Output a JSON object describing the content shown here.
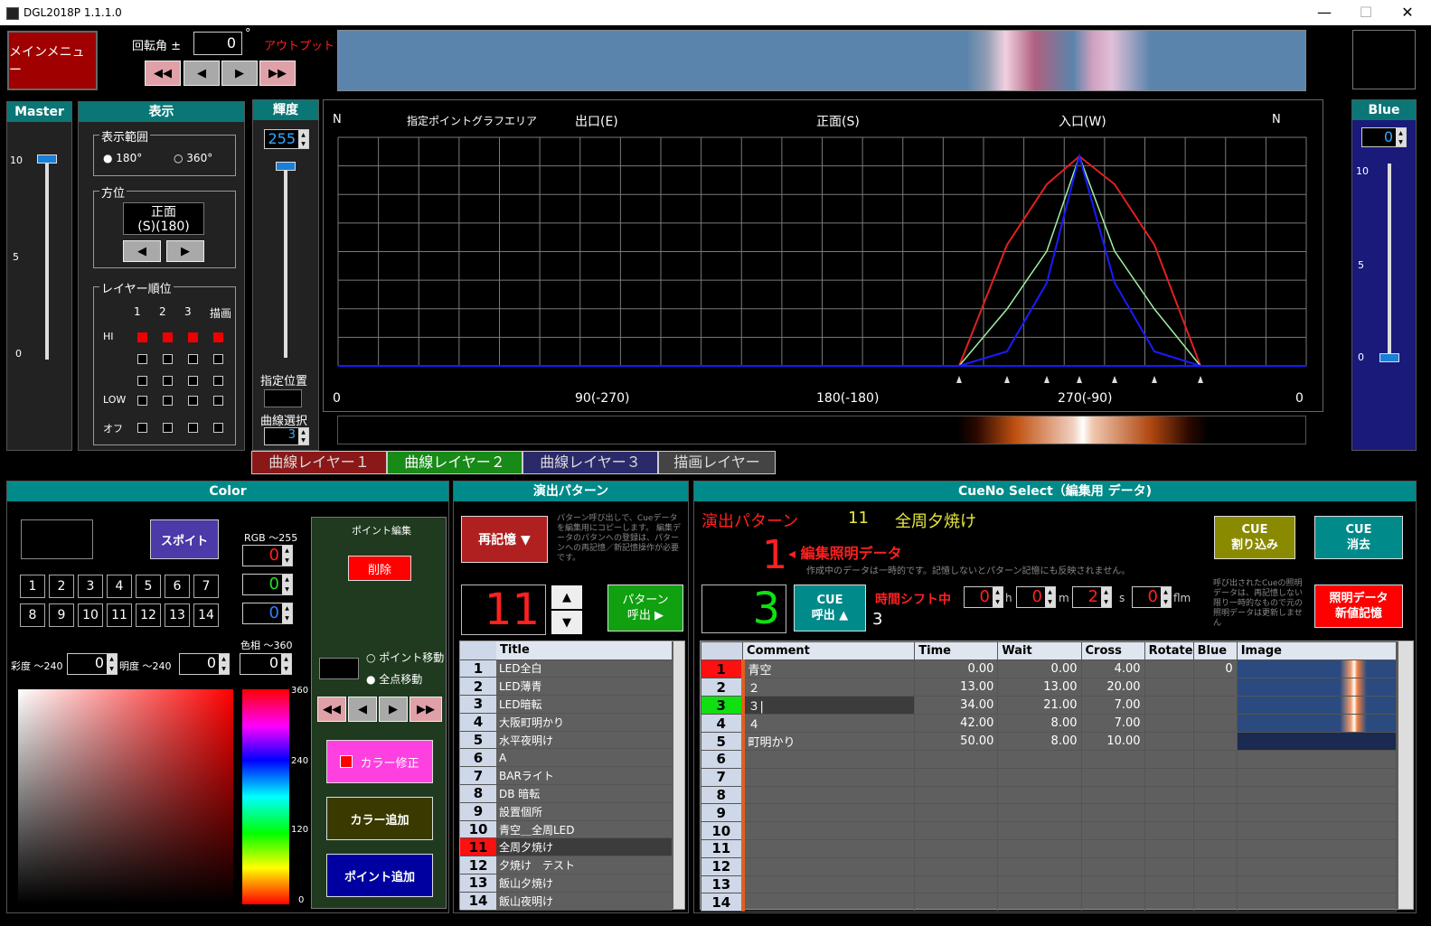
{
  "window": {
    "title": "DGL2018P 1.1.1.0",
    "minimize": "—",
    "maximize": "☐",
    "close": "✕"
  },
  "top": {
    "main_menu": "メインメニュー",
    "rotation_label": "回転角 ±",
    "rotation_value": "0",
    "degree": "°",
    "output_label": "アウトプット",
    "nav": [
      "◀◀",
      "◀",
      "▶",
      "▶▶"
    ]
  },
  "master": {
    "title": "Master",
    "ticks": [
      "10",
      "5",
      "0"
    ]
  },
  "display": {
    "title": "表示",
    "range_label": "表示範囲",
    "range_options": [
      "180°",
      "360°"
    ],
    "range_selected": 0,
    "direction_label": "方位",
    "direction_value_1": "正面",
    "direction_value_2": "(S)(180)",
    "layer_order_label": "レイヤー順位",
    "layer_cols": [
      "1",
      "2",
      "3",
      "描画"
    ],
    "layer_rows": [
      "HI",
      "",
      "",
      "LOW",
      "オフ"
    ],
    "layer_checked": [
      [
        1,
        1,
        1,
        1
      ],
      [
        0,
        0,
        0,
        0
      ],
      [
        0,
        0,
        0,
        0
      ],
      [
        0,
        0,
        0,
        0
      ],
      [
        0,
        0,
        0,
        0
      ]
    ]
  },
  "brightness": {
    "title": "輝度",
    "value": "255",
    "pos_label": "指定位置",
    "curve_label": "曲線選択",
    "curve_value": "3"
  },
  "graph": {
    "n_left": "N",
    "area_label": "指定ポイントグラフエリア",
    "exit": "出口(E)",
    "front": "正面(S)",
    "entry": "入口(W)",
    "n_right": "N",
    "x_labels": [
      "0",
      "90(-270)",
      "180(-180)",
      "270(-90)",
      "0"
    ]
  },
  "blue": {
    "title": "Blue",
    "value": "0",
    "ticks": [
      "10",
      "5",
      "0"
    ]
  },
  "layer_tabs": [
    "曲線レイヤー１",
    "曲線レイヤー２",
    "曲線レイヤー３",
    "描画レイヤー"
  ],
  "color": {
    "title": "Color",
    "spoit": "スポイト",
    "rgb_label": "RGB ～255",
    "rgb_values": [
      "0",
      "0",
      "0"
    ],
    "rgb_colors": [
      "#ff2020",
      "#20e020",
      "#3080ff"
    ],
    "palette_row1": [
      "1",
      "2",
      "3",
      "4",
      "5",
      "6",
      "7"
    ],
    "palette_row2": [
      "8",
      "9",
      "10",
      "11",
      "12",
      "13",
      "14"
    ],
    "saturation_label": "彩度 ～240",
    "saturation_value": "0",
    "brightness_label": "明度 ～240",
    "brightness_value": "0",
    "hue_label": "色相 ～360",
    "hue_value": "0",
    "hue_ticks": [
      "360",
      "240",
      "120",
      "0"
    ],
    "point_edit_title": "ポイント編集",
    "delete": "削除",
    "point_move": "ポイント移動",
    "all_move": "全点移動",
    "color_fix": "カラー修正",
    "color_add": "カラー追加",
    "point_add": "ポイント追加"
  },
  "pattern": {
    "title": "演出パターン",
    "recall": "再記憶 ▼",
    "note": "パターン呼び出しで、Cueデータを編集用にコピーします。 編集データのパタンへの登録は、パターンへの再記憶／新記憶操作が必要です。",
    "number": "11",
    "call": "パターン\n呼出 ▶",
    "col_title": "Title",
    "rows": [
      "LED全白",
      "LED薄青",
      "LED暗転",
      "大阪町明かり",
      "水平夜明け",
      "A",
      "BARライト",
      "DB 暗転",
      "設置個所",
      "青空＿全周LED",
      "全周夕焼け",
      "夕焼け　テスト",
      "飯山夕焼け",
      "飯山夜明け"
    ],
    "selected": 11
  },
  "cue": {
    "title": "CueNo Select（編集用 データ)",
    "pattern_label": "演出パターン",
    "pattern_no": "11",
    "pattern_name": "全周夕焼け",
    "edit_no": "1",
    "edit_label": "◂ 編集照明データ",
    "edit_note": "作成中のデータは一時的です。記憶しないとパターン記憶にも反映されません。",
    "cue_insert": "CUE\n割り込み",
    "cue_delete": "CUE\n消去",
    "cue_number": "3",
    "cue_call": "CUE\n呼出 ▲",
    "cue_call_value": "3",
    "time_shift": "時間シフト中",
    "shift_values": [
      "0",
      "0",
      "2",
      "0"
    ],
    "shift_units": [
      "h",
      "m",
      "s",
      "flm"
    ],
    "right_note": "呼び出されたCueの照明データは、再記憶しない限り一時的なもので元の照明データは更新しません",
    "new_save": "照明データ\n新値記憶",
    "columns": [
      "Comment",
      "Time",
      "Wait",
      "Cross",
      "Rotate",
      "Blue",
      "Image"
    ],
    "rows": [
      {
        "no": "1",
        "comment": "青空",
        "time": "0.00",
        "wait": "0.00",
        "cross": "4.00",
        "rotate": "",
        "blue": "0"
      },
      {
        "no": "2",
        "comment": "２",
        "time": "13.00",
        "wait": "13.00",
        "cross": "20.00",
        "rotate": "",
        "blue": ""
      },
      {
        "no": "3",
        "comment": "３|",
        "time": "34.00",
        "wait": "21.00",
        "cross": "7.00",
        "rotate": "",
        "blue": ""
      },
      {
        "no": "4",
        "comment": "４",
        "time": "42.00",
        "wait": "8.00",
        "cross": "7.00",
        "rotate": "",
        "blue": ""
      },
      {
        "no": "5",
        "comment": "町明かり",
        "time": "50.00",
        "wait": "8.00",
        "cross": "10.00",
        "rotate": "",
        "blue": ""
      },
      {
        "no": "6"
      },
      {
        "no": "7"
      },
      {
        "no": "8"
      },
      {
        "no": "9"
      },
      {
        "no": "10"
      },
      {
        "no": "11"
      },
      {
        "no": "12"
      },
      {
        "no": "13"
      },
      {
        "no": "14"
      }
    ]
  }
}
